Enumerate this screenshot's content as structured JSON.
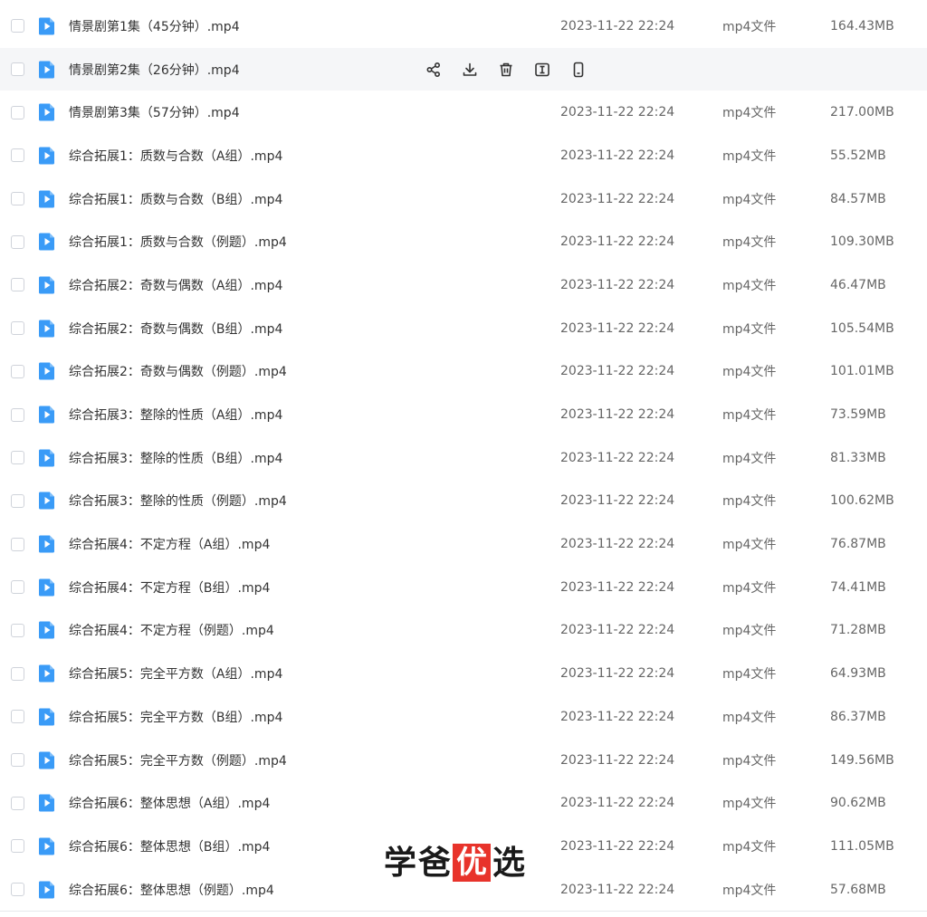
{
  "colors": {
    "icon_blue": "#3a9bf7",
    "hover_bg": "#f5f6f8",
    "seal_red": "#e8332b"
  },
  "files": [
    {
      "name": "情景剧第1集（45分钟）.mp4",
      "date": "2023-11-22 22:24",
      "type": "mp4文件",
      "size": "164.43MB",
      "hover": false
    },
    {
      "name": "情景剧第2集（26分钟）.mp4",
      "date": "",
      "type": "",
      "size": "",
      "hover": true
    },
    {
      "name": "情景剧第3集（57分钟）.mp4",
      "date": "2023-11-22 22:24",
      "type": "mp4文件",
      "size": "217.00MB",
      "hover": false
    },
    {
      "name": "综合拓展1：质数与合数（A组）.mp4",
      "date": "2023-11-22 22:24",
      "type": "mp4文件",
      "size": "55.52MB",
      "hover": false
    },
    {
      "name": "综合拓展1：质数与合数（B组）.mp4",
      "date": "2023-11-22 22:24",
      "type": "mp4文件",
      "size": "84.57MB",
      "hover": false
    },
    {
      "name": "综合拓展1：质数与合数（例题）.mp4",
      "date": "2023-11-22 22:24",
      "type": "mp4文件",
      "size": "109.30MB",
      "hover": false
    },
    {
      "name": "综合拓展2：奇数与偶数（A组）.mp4",
      "date": "2023-11-22 22:24",
      "type": "mp4文件",
      "size": "46.47MB",
      "hover": false
    },
    {
      "name": "综合拓展2：奇数与偶数（B组）.mp4",
      "date": "2023-11-22 22:24",
      "type": "mp4文件",
      "size": "105.54MB",
      "hover": false
    },
    {
      "name": "综合拓展2：奇数与偶数（例题）.mp4",
      "date": "2023-11-22 22:24",
      "type": "mp4文件",
      "size": "101.01MB",
      "hover": false
    },
    {
      "name": "综合拓展3：整除的性质（A组）.mp4",
      "date": "2023-11-22 22:24",
      "type": "mp4文件",
      "size": "73.59MB",
      "hover": false
    },
    {
      "name": "综合拓展3：整除的性质（B组）.mp4",
      "date": "2023-11-22 22:24",
      "type": "mp4文件",
      "size": "81.33MB",
      "hover": false
    },
    {
      "name": "综合拓展3：整除的性质（例题）.mp4",
      "date": "2023-11-22 22:24",
      "type": "mp4文件",
      "size": "100.62MB",
      "hover": false
    },
    {
      "name": "综合拓展4：不定方程（A组）.mp4",
      "date": "2023-11-22 22:24",
      "type": "mp4文件",
      "size": "76.87MB",
      "hover": false
    },
    {
      "name": "综合拓展4：不定方程（B组）.mp4",
      "date": "2023-11-22 22:24",
      "type": "mp4文件",
      "size": "74.41MB",
      "hover": false
    },
    {
      "name": "综合拓展4：不定方程（例题）.mp4",
      "date": "2023-11-22 22:24",
      "type": "mp4文件",
      "size": "71.28MB",
      "hover": false
    },
    {
      "name": "综合拓展5：完全平方数（A组）.mp4",
      "date": "2023-11-22 22:24",
      "type": "mp4文件",
      "size": "64.93MB",
      "hover": false
    },
    {
      "name": "综合拓展5：完全平方数（B组）.mp4",
      "date": "2023-11-22 22:24",
      "type": "mp4文件",
      "size": "86.37MB",
      "hover": false
    },
    {
      "name": "综合拓展5：完全平方数（例题）.mp4",
      "date": "2023-11-22 22:24",
      "type": "mp4文件",
      "size": "149.56MB",
      "hover": false
    },
    {
      "name": "综合拓展6：整体思想（A组）.mp4",
      "date": "2023-11-22 22:24",
      "type": "mp4文件",
      "size": "90.62MB",
      "hover": false
    },
    {
      "name": "综合拓展6：整体思想（B组）.mp4",
      "date": "2023-11-22 22:24",
      "type": "mp4文件",
      "size": "111.05MB",
      "hover": false
    },
    {
      "name": "综合拓展6：整体思想（例题）.mp4",
      "date": "2023-11-22 22:24",
      "type": "mp4文件",
      "size": "57.68MB",
      "hover": false
    }
  ],
  "hover_actions": [
    "share-icon",
    "download-icon",
    "delete-icon",
    "rename-icon",
    "mobile-icon"
  ],
  "watermark": {
    "chars": [
      "学",
      "爸",
      "优",
      "选"
    ]
  }
}
